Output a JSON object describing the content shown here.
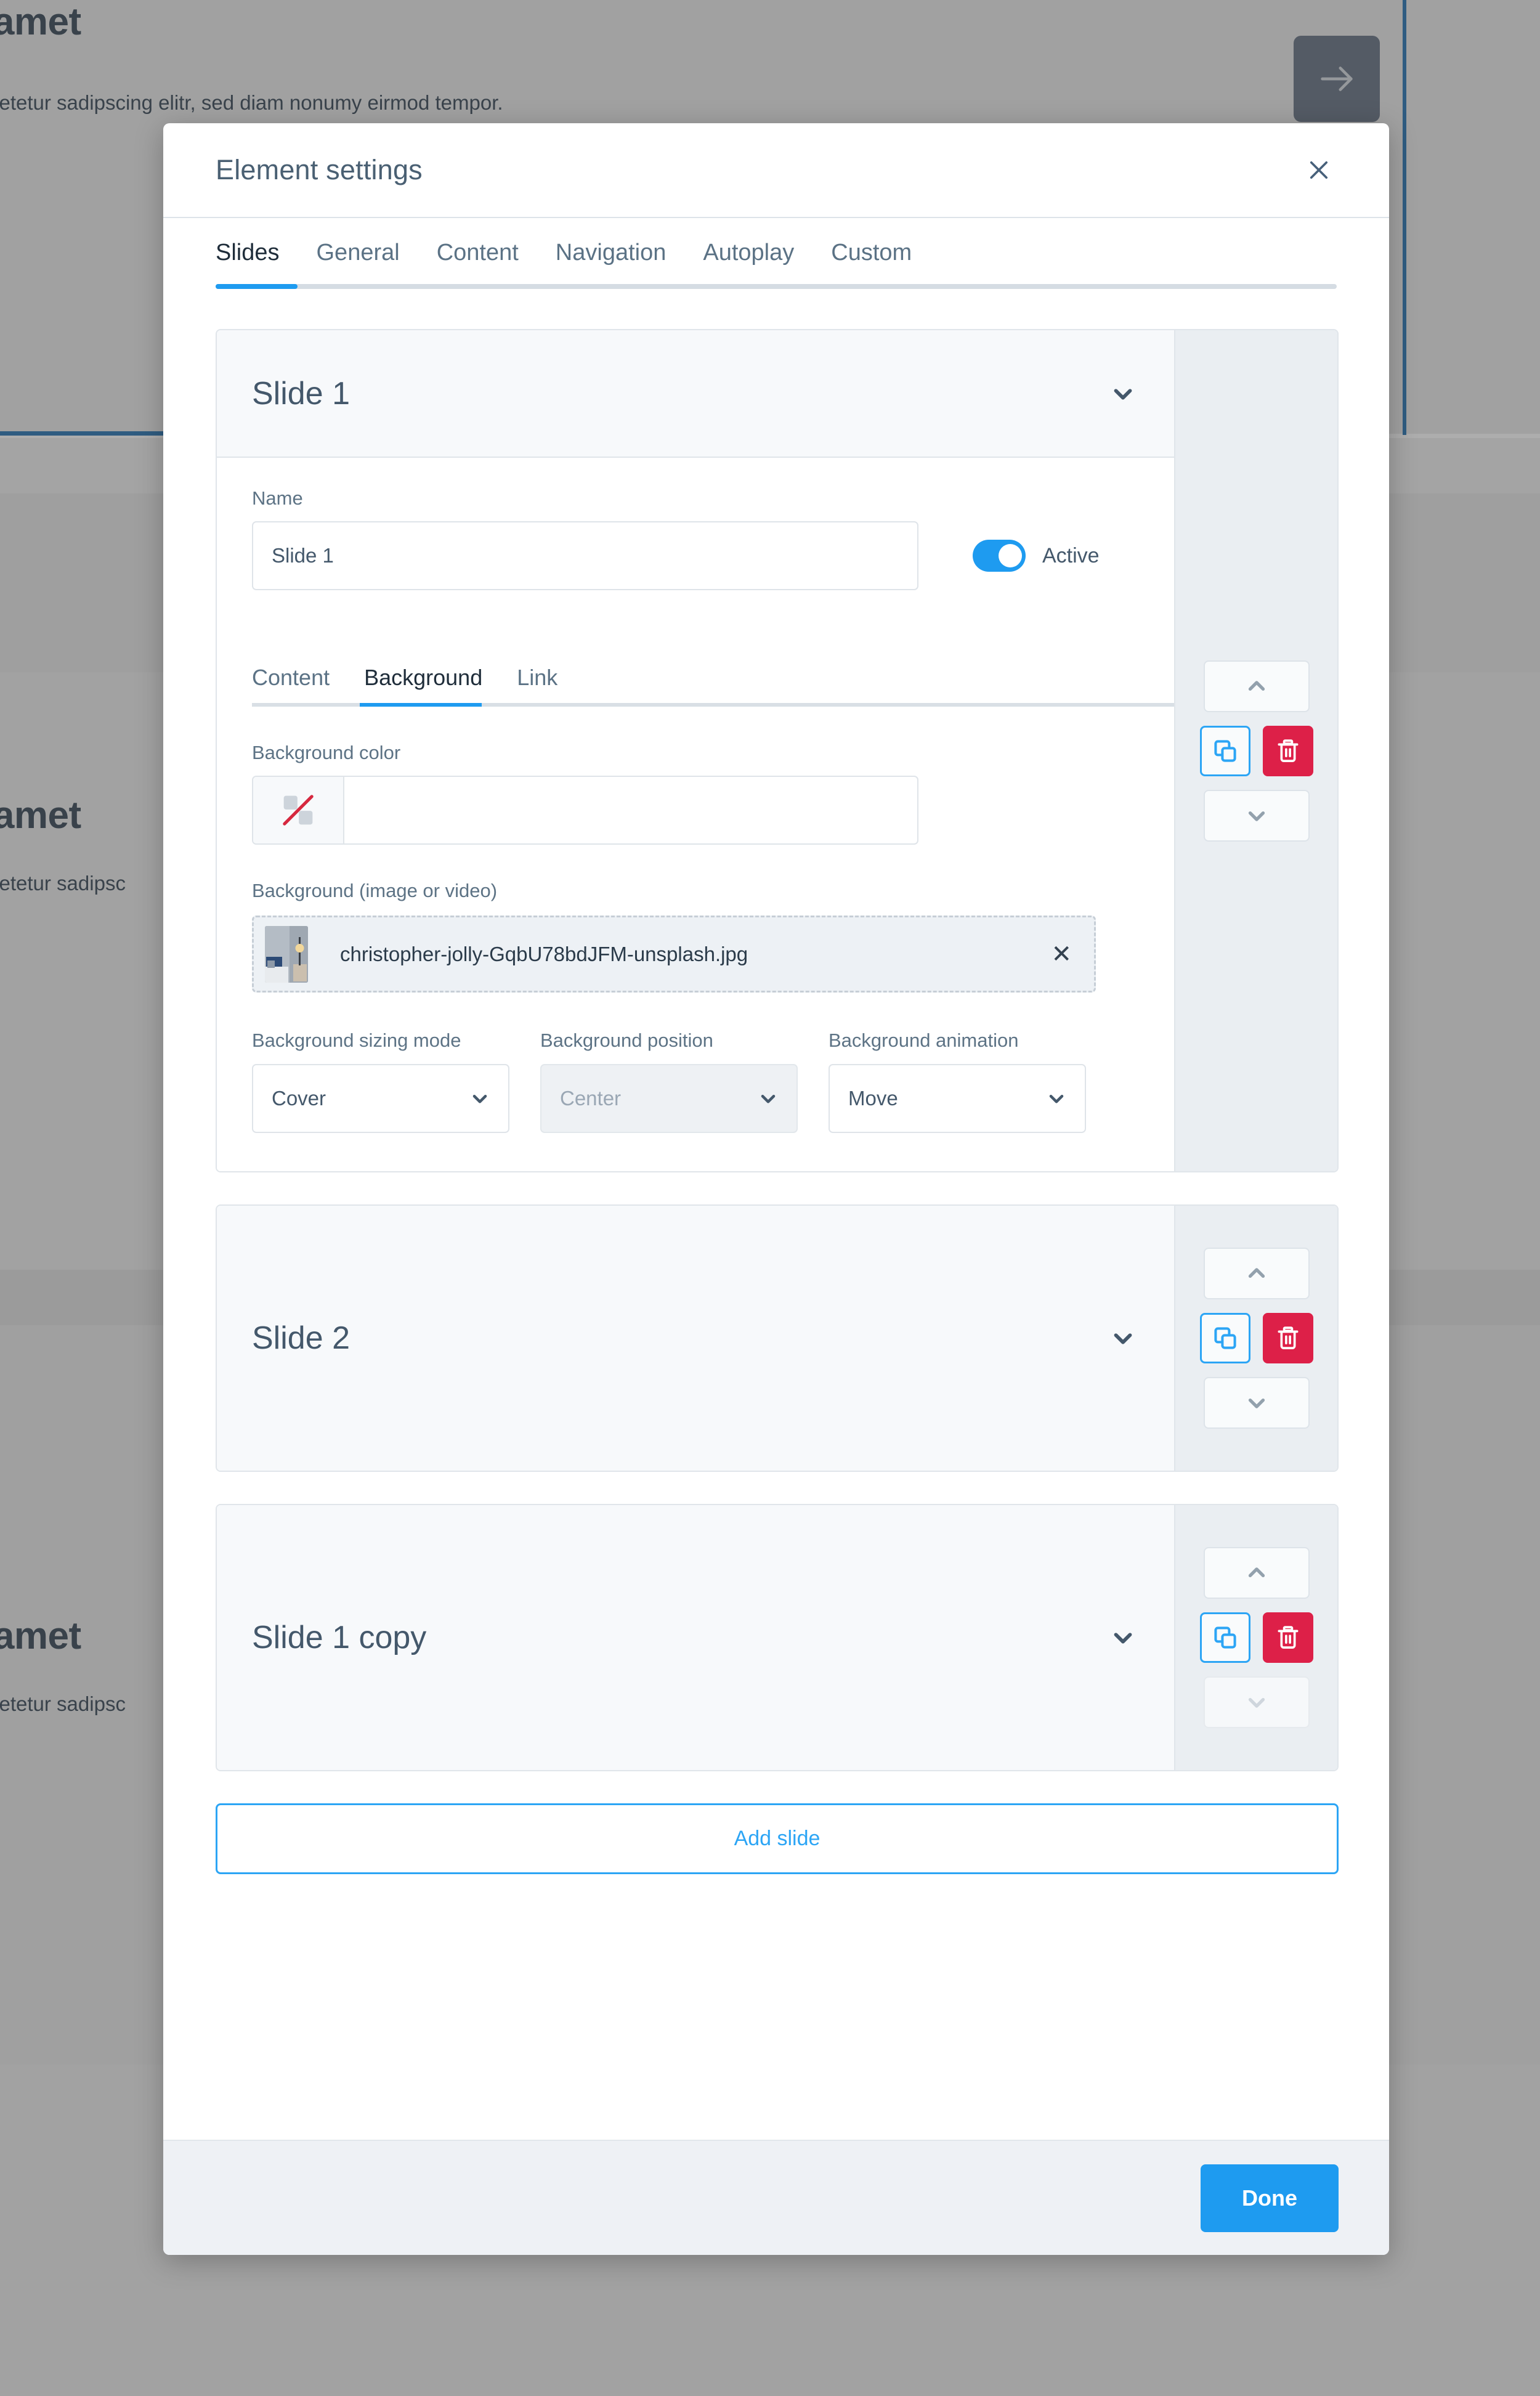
{
  "background_page": {
    "hero_blocks": [
      {
        "title": "t amet",
        "subtitle": "setetur sadipscing elitr, sed diam nonumy eirmod tempor."
      },
      {
        "title": "t amet",
        "subtitle": "setetur sadipsc"
      },
      {
        "title": "t amet",
        "subtitle": "setetur sadipsc"
      }
    ],
    "next_arrow_icon": "arrow-right-icon"
  },
  "modal": {
    "title": "Element settings",
    "close_icon": "close-icon",
    "tabs": [
      {
        "label": "Slides",
        "active": true
      },
      {
        "label": "General",
        "active": false
      },
      {
        "label": "Content",
        "active": false
      },
      {
        "label": "Navigation",
        "active": false
      },
      {
        "label": "Autoplay",
        "active": false
      },
      {
        "label": "Custom",
        "active": false
      }
    ],
    "footer": {
      "done_label": "Done"
    },
    "add_slide_label": "Add slide",
    "accent_color": "#1e9bf0",
    "danger_color": "#dd2048"
  },
  "slides": [
    {
      "header_title": "Slide 1",
      "expanded": true,
      "collapse_icon": "chevron-down-icon",
      "name_label": "Name",
      "name_value": "Slide 1",
      "active_toggle": {
        "label": "Active",
        "on": true
      },
      "inner_tabs": [
        {
          "label": "Content",
          "active": false
        },
        {
          "label": "Background",
          "active": true
        },
        {
          "label": "Link",
          "active": false
        }
      ],
      "background_color": {
        "label": "Background color",
        "value": "",
        "swatch_icon": "no-color-icon"
      },
      "background_media": {
        "label": "Background (image or video)",
        "file_name": "christopher-jolly-GqbU78bdJFM-unsplash.jpg",
        "remove_icon": "close-icon",
        "thumbnail_icon": "image-thumbnail"
      },
      "selects": [
        {
          "label": "Background sizing mode",
          "value": "Cover",
          "disabled": false
        },
        {
          "label": "Background position",
          "value": "Center",
          "disabled": true
        },
        {
          "label": "Background animation",
          "value": "Move",
          "disabled": false
        }
      ],
      "controls": {
        "move_up_icon": "chevron-up-icon",
        "duplicate_icon": "copy-icon",
        "delete_icon": "trash-icon",
        "move_down_icon": "chevron-down-icon",
        "move_down_disabled": false
      }
    },
    {
      "header_title": "Slide 2",
      "expanded": false,
      "collapse_icon": "chevron-down-icon",
      "controls": {
        "move_up_icon": "chevron-up-icon",
        "duplicate_icon": "copy-icon",
        "delete_icon": "trash-icon",
        "move_down_icon": "chevron-down-icon",
        "move_down_disabled": false
      }
    },
    {
      "header_title": "Slide 1 copy",
      "expanded": false,
      "collapse_icon": "chevron-down-icon",
      "controls": {
        "move_up_icon": "chevron-up-icon",
        "duplicate_icon": "copy-icon",
        "delete_icon": "trash-icon",
        "move_down_icon": "chevron-down-icon",
        "move_down_disabled": true
      }
    }
  ]
}
